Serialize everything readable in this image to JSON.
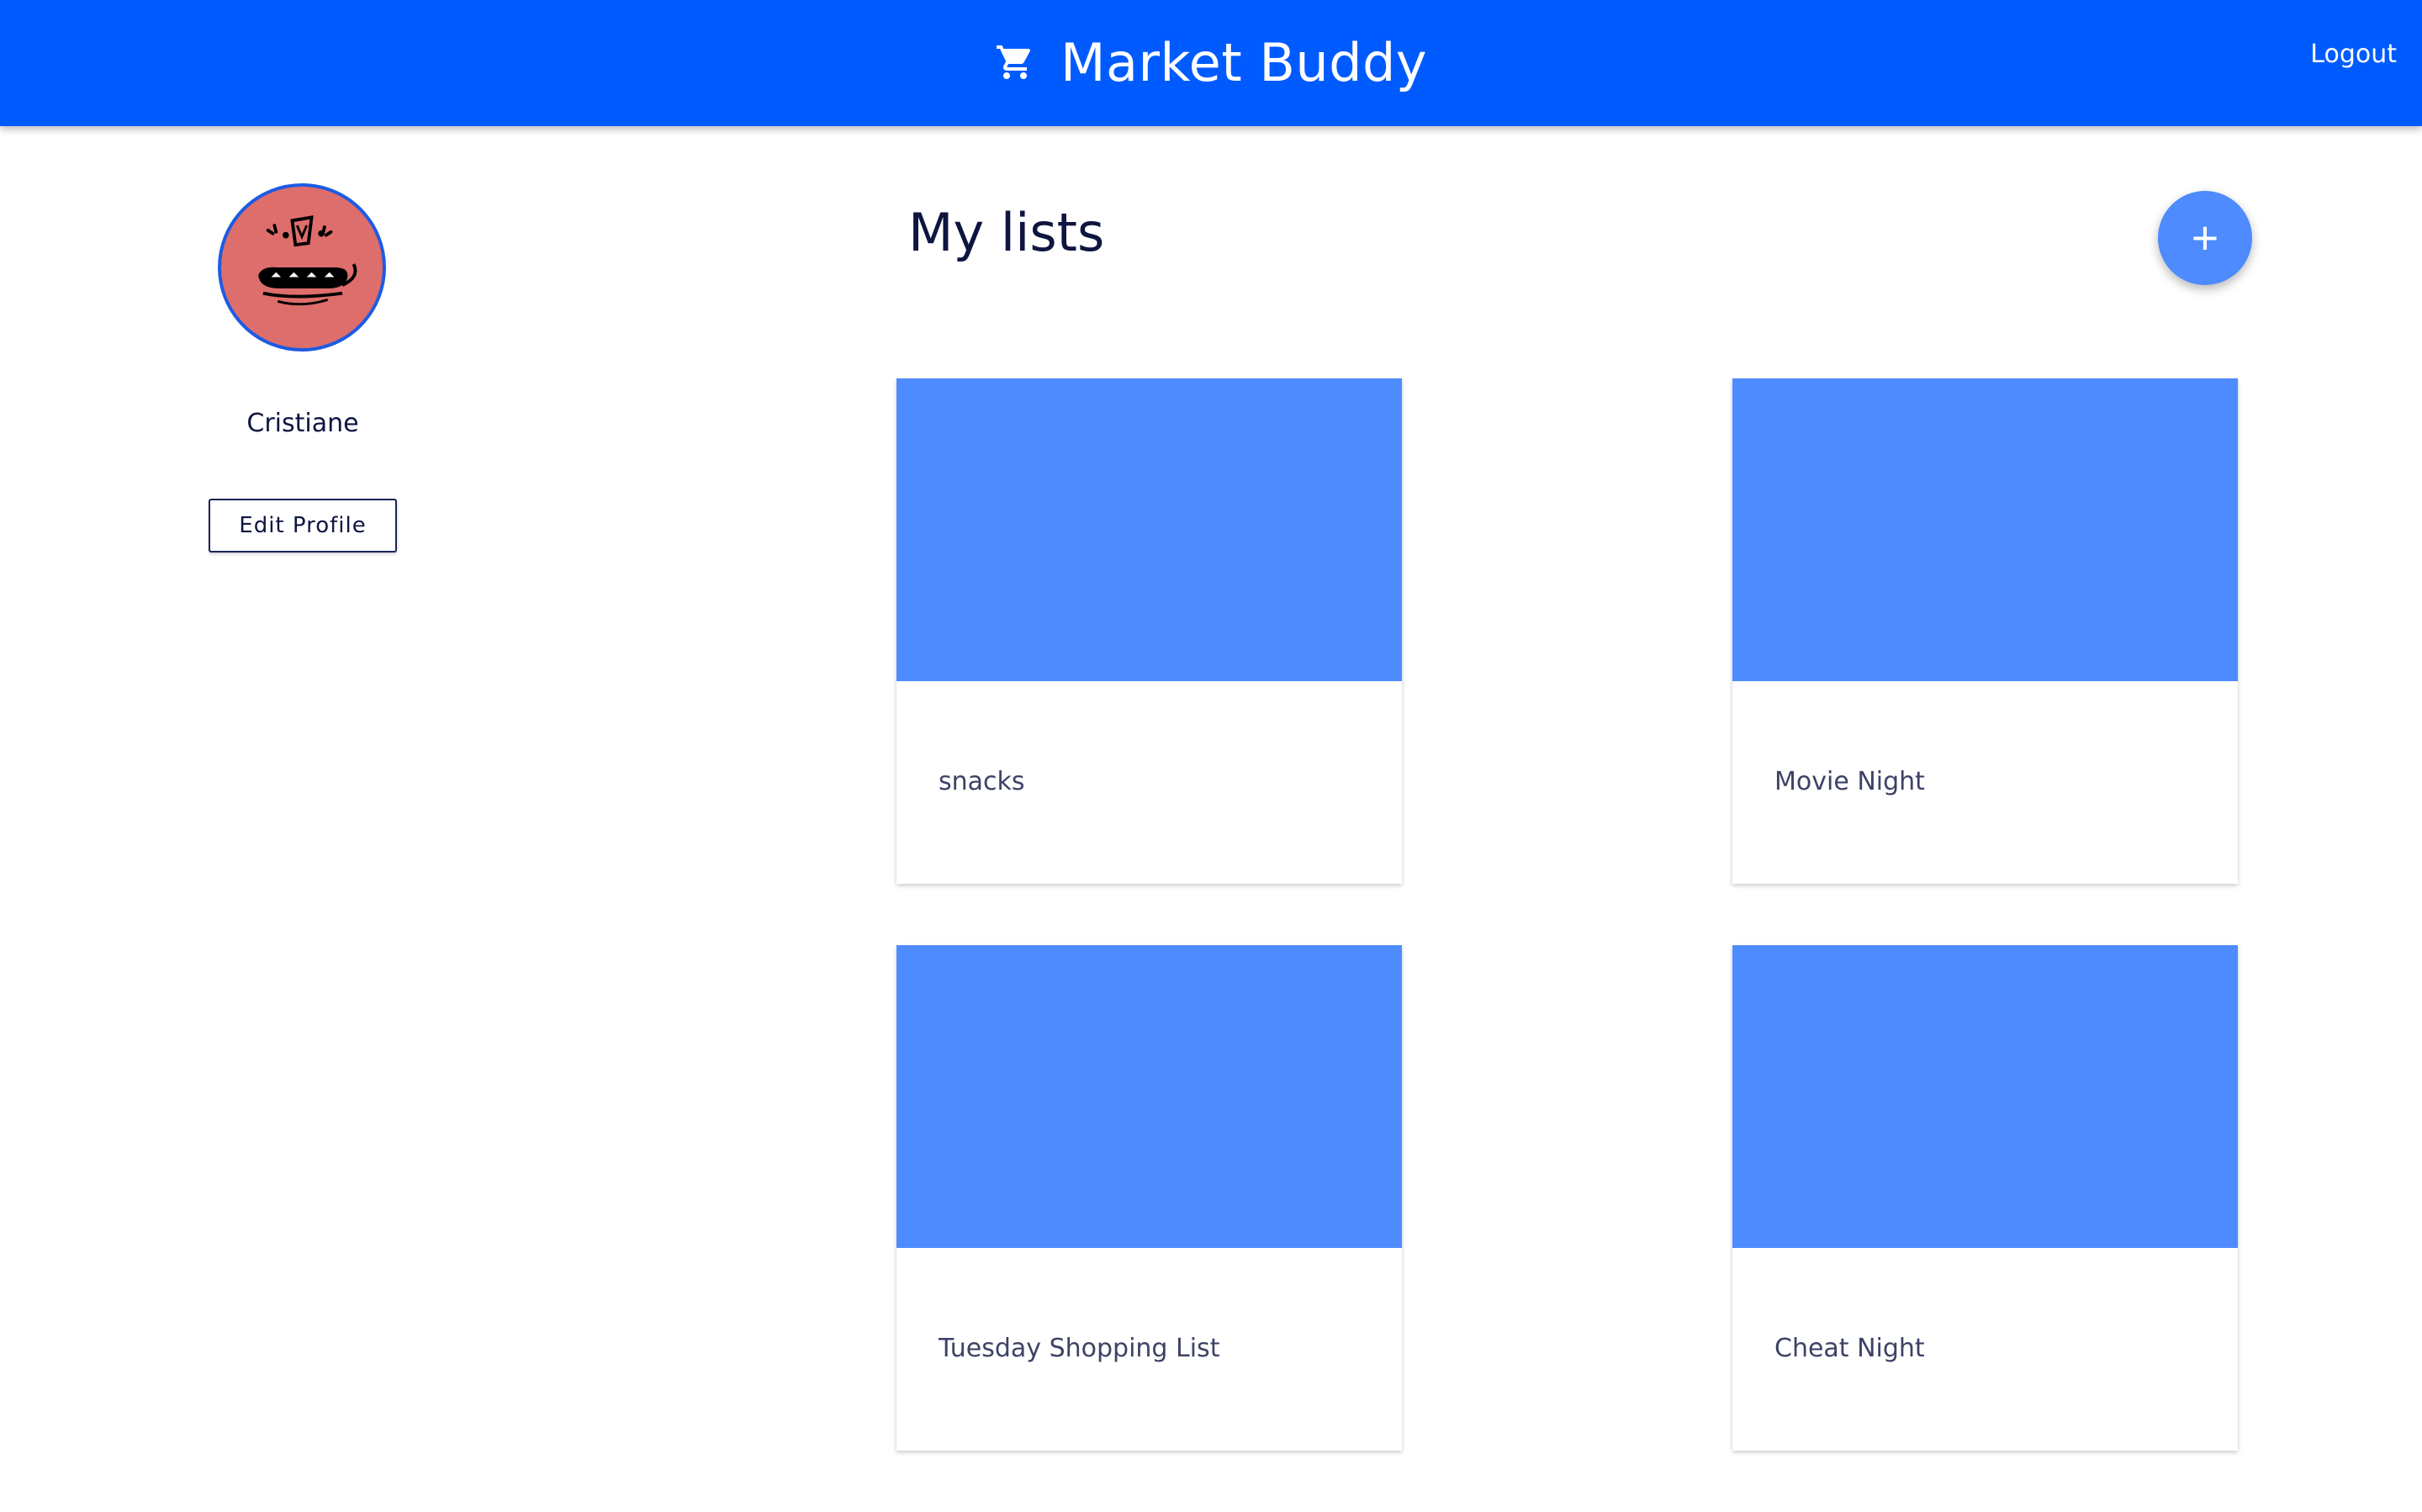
{
  "header": {
    "app_title": "Market Buddy",
    "cart_icon": "shopping-cart-icon",
    "logout_label": "Logout",
    "background_color": "#005bff"
  },
  "profile": {
    "avatar_icon": "monster-avatar-icon",
    "username": "Cristiane",
    "edit_button_label": "Edit Profile"
  },
  "main": {
    "title": "My lists",
    "add_button_label": "+",
    "lists": [
      {
        "name": "snacks"
      },
      {
        "name": "Movie Night"
      },
      {
        "name": "Tuesday Shopping List"
      },
      {
        "name": "Cheat Night"
      }
    ],
    "card_image_color": "#4d8bff"
  }
}
